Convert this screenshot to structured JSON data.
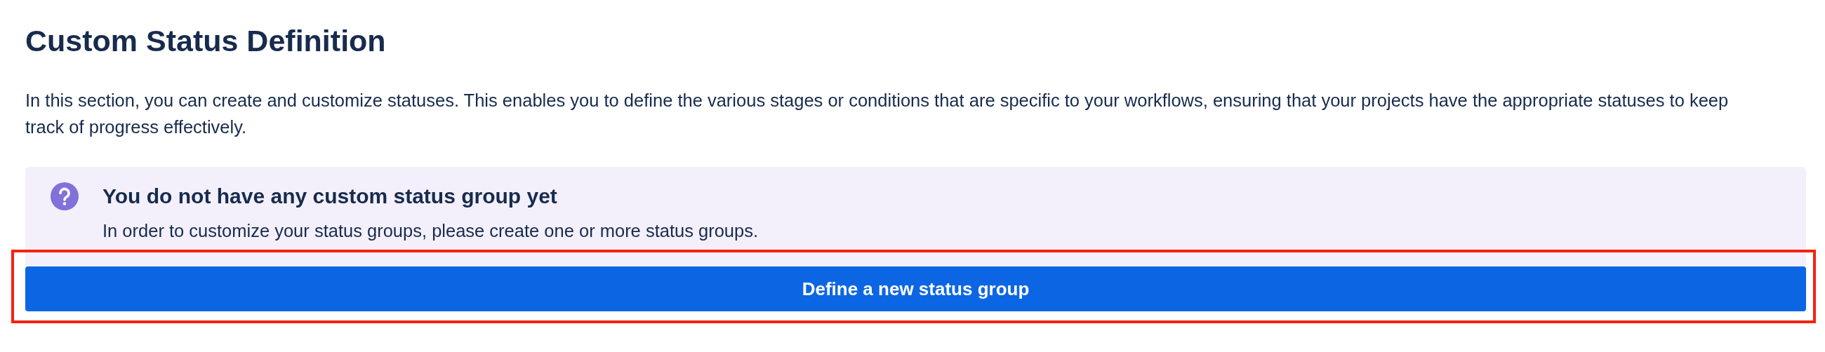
{
  "title": "Custom Status Definition",
  "description": "In this section, you can create and customize statuses. This enables you to define the various stages or conditions that are specific to your workflows, ensuring that your projects have the appropriate statuses to keep track of progress effectively.",
  "notice": {
    "kind": "info",
    "heading": "You do not have any custom status group yet",
    "body": "In order to customize your status groups, please create one or more status groups."
  },
  "button": {
    "label": "Define a new status group",
    "highlighted": true
  }
}
